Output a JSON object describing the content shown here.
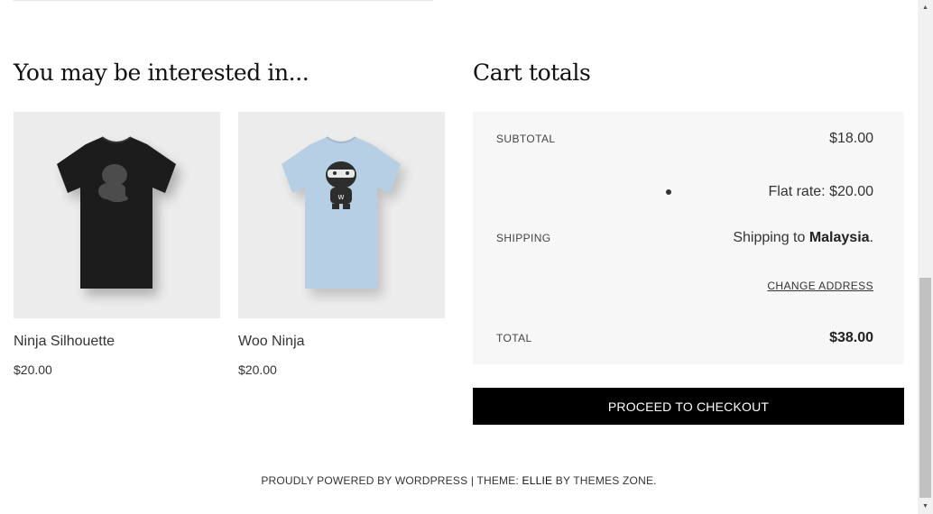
{
  "related": {
    "heading": "You may be interested in...",
    "products": [
      {
        "name": "Ninja Silhouette",
        "price": "$20.00",
        "shirt_color": "#1c1c1c"
      },
      {
        "name": "Woo Ninja",
        "price": "$20.00",
        "shirt_color": "#b7cfe4"
      }
    ]
  },
  "cart": {
    "heading": "Cart totals",
    "subtotal_label": "SUBTOTAL",
    "subtotal_value": "$18.00",
    "shipping_label": "SHIPPING",
    "shipping_method": "Flat rate: $20.00",
    "shipping_to_prefix": "Shipping to ",
    "shipping_country": "Malaysia",
    "shipping_to_suffix": ".",
    "change_address": "CHANGE ADDRESS",
    "total_label": "TOTAL",
    "total_value": "$38.00",
    "checkout_label": "PROCEED TO CHECKOUT"
  },
  "footer": {
    "powered_prefix": "PROUDLY POWERED BY WORDPRESS | THEME: ",
    "theme_name": "ELLIE",
    "by_text": " BY THEMES ZONE."
  },
  "scrollbar": {
    "position_percent": 60
  }
}
